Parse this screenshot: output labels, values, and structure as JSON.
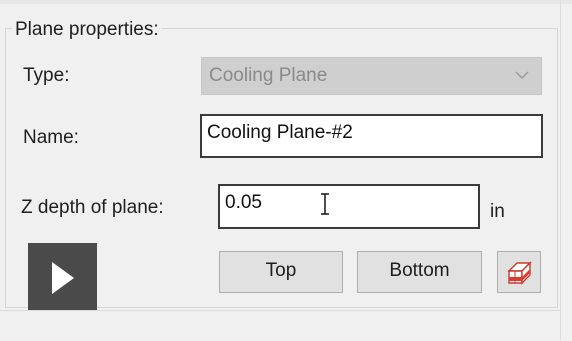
{
  "group": {
    "title": "Plane properties:"
  },
  "type_field": {
    "label": "Type:",
    "value": "Cooling Plane",
    "icon": "chevron-down-icon",
    "disabled": true
  },
  "name_field": {
    "label": "Name:",
    "value": "Cooling Plane-#2"
  },
  "z_depth_field": {
    "label": "Z depth of plane:",
    "value": "0.05",
    "unit": "in"
  },
  "buttons": {
    "top_label": "Top",
    "bottom_label": "Bottom",
    "plane_icon": "plane-cube-icon"
  },
  "video": {
    "play_icon": "play-icon"
  },
  "colors": {
    "accent_red": "#e03a2e",
    "play_bg": "#4a4a4a"
  }
}
